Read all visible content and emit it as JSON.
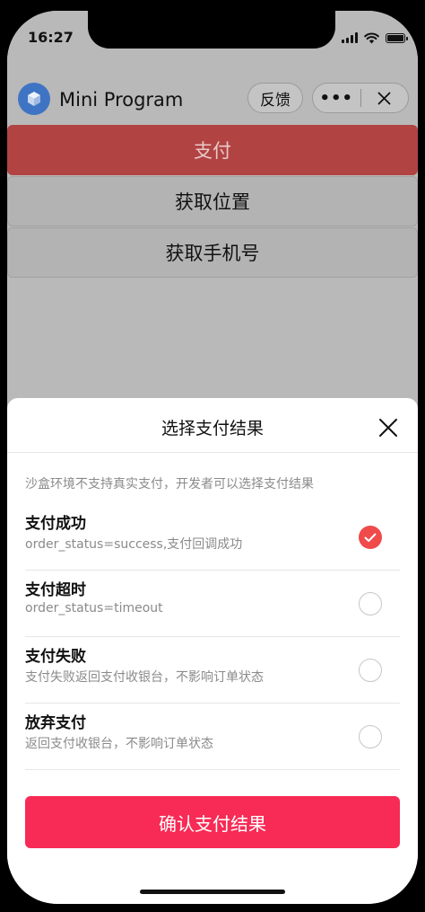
{
  "status_bar": {
    "time": "16:27"
  },
  "nav": {
    "title": "Mini Program",
    "feedback_label": "反馈",
    "more_label": "•••",
    "logo_icon": "cube-icon",
    "close_icon": "close-icon"
  },
  "page_buttons": {
    "pay": "支付",
    "location": "获取位置",
    "phone": "获取手机号"
  },
  "sheet": {
    "title": "选择支付结果",
    "hint": "沙盒环境不支持真实支付，开发者可以选择支付结果",
    "options": [
      {
        "title": "支付成功",
        "desc": "order_status=success,支付回调成功",
        "selected": true
      },
      {
        "title": "支付超时",
        "desc": "order_status=timeout",
        "selected": false
      },
      {
        "title": "支付失败",
        "desc": "支付失败返回支付收银台，不影响订单状态",
        "selected": false
      },
      {
        "title": "放弃支付",
        "desc": "返回支付收银台，不影响订单状态",
        "selected": false
      }
    ],
    "confirm_label": "确认支付结果"
  },
  "colors": {
    "accent": "#f72b55",
    "selected_radio": "#f04a4a",
    "pay_button": "#b24343"
  }
}
